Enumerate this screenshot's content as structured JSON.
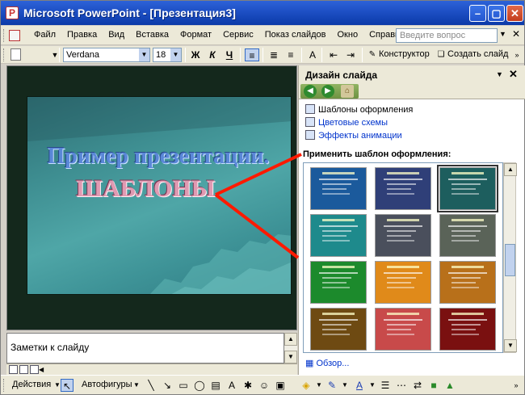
{
  "titlebar": {
    "title": "Microsoft PowerPoint - [Презентация3]",
    "buttons": [
      "minimize-icon",
      "maximize-icon",
      "close-icon"
    ]
  },
  "menubar": {
    "items": [
      {
        "label": "Файл"
      },
      {
        "label": "Правка"
      },
      {
        "label": "Вид"
      },
      {
        "label": "Вставка"
      },
      {
        "label": "Формат"
      },
      {
        "label": "Сервис"
      },
      {
        "label": "Показ слайдов"
      },
      {
        "label": "Окно"
      },
      {
        "label": "Справка"
      }
    ],
    "search_placeholder": "Введите вопрос"
  },
  "toolbar": {
    "font": "Verdana",
    "size": "18",
    "bold": "Ж",
    "italic": "К",
    "underline": "Ч",
    "designer_label": "Конструктор",
    "new_slide_label": "Создать слайд"
  },
  "slide": {
    "title": "Пример презентации.",
    "subtitle": "ШАБЛОНЫ"
  },
  "notes": {
    "placeholder": "Заметки к слайду"
  },
  "taskpane": {
    "title": "Дизайн слайда",
    "links": [
      {
        "label": "Шаблоны оформления",
        "icon": "templates-icon"
      },
      {
        "label": "Цветовые схемы",
        "icon": "color-schemes-icon"
      },
      {
        "label": "Эффекты анимации",
        "icon": "animation-effects-icon"
      }
    ],
    "section_label": "Применить шаблон оформления:",
    "browse_label": "Обзор...",
    "thumbnails": [
      {
        "bg": "#1b5a9c",
        "accent": "#cfe7ff"
      },
      {
        "bg": "#2f3f78",
        "accent": "#b9c8f0"
      },
      {
        "bg": "#1d5e5e",
        "accent": "#d7f0ee"
      },
      {
        "bg": "#1e8a8c",
        "accent": "#e0fafa"
      },
      {
        "bg": "#4a4f5c",
        "accent": "#dcdde3"
      },
      {
        "bg": "#5a6358",
        "accent": "#e6ebe2"
      },
      {
        "bg": "#1c8a2c",
        "accent": "#d9f7d2"
      },
      {
        "bg": "#e08a1a",
        "accent": "#fff1c8"
      },
      {
        "bg": "#b8701a",
        "accent": "#fbe0b8"
      },
      {
        "bg": "#6e4a12",
        "accent": "#f0d8a8"
      },
      {
        "bg": "#c84a4a",
        "accent": "#f7d8c8"
      },
      {
        "bg": "#7a1010",
        "accent": "#f2c8c0"
      }
    ]
  },
  "drawbar": {
    "actions_label": "Действия",
    "autoshapes_label": "Автофигуры"
  },
  "colors": {
    "titlebar": "#0b3aa8",
    "annotation": "#ff1a00",
    "link": "#0033cc"
  }
}
